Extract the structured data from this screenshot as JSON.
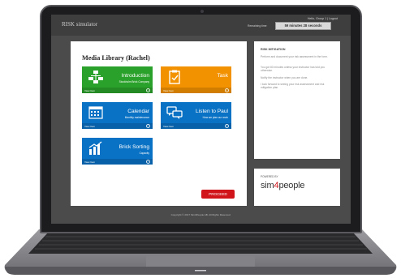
{
  "header": {
    "app_title": "RISK simulator",
    "user_line": "Hello, Group 1 | Logout",
    "remaining_label": "Remaining time",
    "timer": "59 minutes 28 seconds"
  },
  "library": {
    "title": "Media Library (Rachel)",
    "tiles": [
      {
        "title": "Introduction",
        "subtitle": "Stockholm Brick Company",
        "view": "View Item",
        "color": "#2aa12a",
        "icon": "org-chart-icon"
      },
      {
        "title": "Task",
        "subtitle": "",
        "view": "View Item",
        "color": "#f39200",
        "icon": "clipboard-check-icon"
      },
      {
        "title": "Calendar",
        "subtitle": "Monthly maintenance",
        "view": "View Item",
        "color": "#0a72c4",
        "icon": "calendar-icon"
      },
      {
        "title": "Listen to Paul",
        "subtitle": "How we plan our work",
        "view": "View Item",
        "color": "#0a72c4",
        "icon": "chat-bubbles-icon"
      },
      {
        "title": "Brick Sorting",
        "subtitle": "Capacity",
        "view": "View Item",
        "color": "#0a72c4",
        "icon": "bar-chart-icon"
      }
    ],
    "proceed_label": "PROCEED"
  },
  "sidebar": {
    "heading": "RISK MITIGATION",
    "p1": "Perform and document your risk assessment in the form.",
    "p2": "You got 60 minutes unless your instructor has told you otherwise.",
    "p3": "Notify the instructor when you are done.",
    "p4": "I look forward to seeing your risk assessment and risk mitigation plan."
  },
  "powered": {
    "label": "POWERED BY",
    "logo_pre": "sim",
    "logo_num": "4",
    "logo_post": "people"
  },
  "footer": {
    "copyright": "Copyright © 2017 Sim4People AB. All Rights Reserved."
  },
  "colors": {
    "proceed": "#d0141a",
    "logo_accent": "#d0141a"
  }
}
